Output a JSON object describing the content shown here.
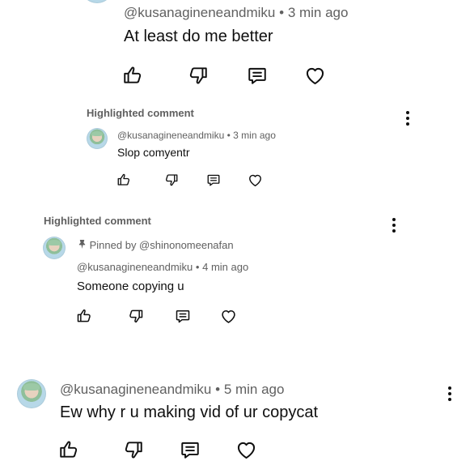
{
  "comments": [
    {
      "author": "@kusanagineneandmiku",
      "time": "3 min ago",
      "text": "At least do me better"
    },
    {
      "highlight_label": "Highlighted comment",
      "author": "@kusanagineneandmiku",
      "time": "3 min ago",
      "text": "Slop comyentr"
    },
    {
      "highlight_label": "Highlighted comment",
      "pinned_by": "Pinned by @shinonomeenafan",
      "author": "@kusanagineneandmiku",
      "time": "4 min ago",
      "text": "Someone copying u"
    },
    {
      "author": "@kusanagineneandmiku",
      "time": "5 min ago",
      "text": "Ew why r u making vid of ur copycat"
    }
  ],
  "separator": "•",
  "icons": [
    "like-icon",
    "dislike-icon",
    "reply-icon",
    "heart-icon",
    "more-vertical-icon",
    "pin-icon"
  ]
}
